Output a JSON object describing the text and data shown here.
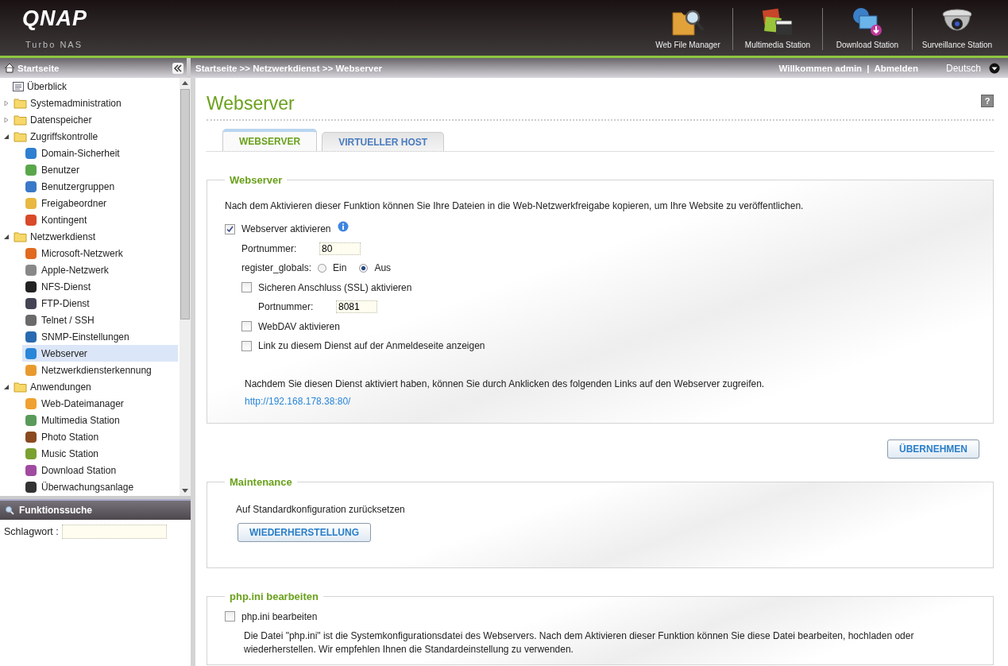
{
  "header": {
    "logo": "QNAP",
    "subtitle": "Turbo NAS",
    "shortcuts": [
      {
        "kind": "files",
        "label": "Web File Manager"
      },
      {
        "kind": "media",
        "label": "Multimedia Station"
      },
      {
        "kind": "download",
        "label": "Download Station"
      },
      {
        "kind": "camera",
        "label": "Surveillance Station"
      }
    ]
  },
  "sidebar": {
    "title": "Startseite",
    "tree": [
      {
        "label": "Überblick",
        "kind": "page"
      },
      {
        "label": "Systemadministration",
        "kind": "folder",
        "expanded": false
      },
      {
        "label": "Datenspeicher",
        "kind": "folder",
        "expanded": false
      },
      {
        "label": "Zugriffskontrolle",
        "kind": "folder",
        "expanded": true,
        "children": [
          {
            "label": "Domain-Sicherheit",
            "kind": "item",
            "selected": false
          },
          {
            "label": "Benutzer",
            "kind": "item",
            "selected": false
          },
          {
            "label": "Benutzergruppen",
            "kind": "item",
            "selected": false
          },
          {
            "label": "Freigabeordner",
            "kind": "item",
            "selected": false
          },
          {
            "label": "Kontingent",
            "kind": "item",
            "selected": false
          }
        ]
      },
      {
        "label": "Netzwerkdienst",
        "kind": "folder",
        "expanded": true,
        "children": [
          {
            "label": "Microsoft-Netzwerk",
            "kind": "item",
            "selected": false
          },
          {
            "label": "Apple-Netzwerk",
            "kind": "item",
            "selected": false
          },
          {
            "label": "NFS-Dienst",
            "kind": "item",
            "selected": false
          },
          {
            "label": "FTP-Dienst",
            "kind": "item",
            "selected": false
          },
          {
            "label": "Telnet / SSH",
            "kind": "item",
            "selected": false
          },
          {
            "label": "SNMP-Einstellungen",
            "kind": "item",
            "selected": false
          },
          {
            "label": "Webserver",
            "kind": "item",
            "selected": true
          },
          {
            "label": "Netzwerkdiensterkennung",
            "kind": "item",
            "selected": false
          }
        ]
      },
      {
        "label": "Anwendungen",
        "kind": "folder",
        "expanded": true,
        "children": [
          {
            "label": "Web-Dateimanager",
            "kind": "item",
            "selected": false
          },
          {
            "label": "Multimedia Station",
            "kind": "item",
            "selected": false
          },
          {
            "label": "Photo Station",
            "kind": "item",
            "selected": false
          },
          {
            "label": "Music Station",
            "kind": "item",
            "selected": false
          },
          {
            "label": "Download Station",
            "kind": "item",
            "selected": false
          },
          {
            "label": "Überwachungsanlage",
            "kind": "item",
            "selected": false
          }
        ]
      }
    ],
    "search": {
      "title": "Funktionssuche",
      "label": "Schlagwort :"
    }
  },
  "topbar": {
    "breadcrumb": "Startseite >> Netzwerkdienst >> Webserver",
    "welcome": "Willkommen admin",
    "separator": "|",
    "logout": "Abmelden",
    "language": "Deutsch"
  },
  "page": {
    "title": "Webserver",
    "help": "?",
    "tabs": [
      {
        "label": "WEBSERVER",
        "selected": true
      },
      {
        "label": "VIRTUELLER HOST",
        "selected": false
      }
    ]
  },
  "webserver": {
    "legend": "Webserver",
    "description": "Nach dem Aktivieren dieser Funktion können Sie Ihre Dateien in die Web-Netzwerkfreigabe kopieren, um Ihre Website zu veröffentlichen.",
    "options": [
      {
        "kind": "checkbox",
        "label": "Webserver aktivieren",
        "checked": true,
        "info": true,
        "children": [
          {
            "kind": "field",
            "label": "Portnummer:",
            "value": "80"
          },
          {
            "kind": "radio",
            "label": "register_globals:",
            "choices": [
              {
                "label": "Ein",
                "selected": false
              },
              {
                "label": "Aus",
                "selected": true
              }
            ]
          },
          {
            "kind": "checkbox",
            "label": "Sicheren Anschluss (SSL) aktivieren",
            "checked": false,
            "children": [
              {
                "kind": "field",
                "label": "Portnummer:",
                "value": "8081"
              }
            ]
          },
          {
            "kind": "checkbox",
            "label": "WebDAV aktivieren",
            "checked": false
          },
          {
            "kind": "checkbox",
            "label": "Link zu diesem Dienst auf der Anmeldeseite anzeigen",
            "checked": false
          }
        ]
      }
    ],
    "note": "Nachdem Sie diesen Dienst aktiviert haben, können Sie durch Anklicken des folgenden Links auf den Webserver zugreifen.",
    "link": "http://192.168.178.38:80/"
  },
  "apply_button": "ÜBERNEHMEN",
  "maintenance": {
    "legend": "Maintenance",
    "text": "Auf Standardkonfiguration zurücksetzen",
    "button": "WIEDERHERSTELLUNG"
  },
  "phpini": {
    "legend": "php.ini bearbeiten",
    "checkbox": {
      "label": "php.ini bearbeiten",
      "checked": false
    },
    "description": "Die Datei \"php.ini\" ist die Systemkonfigurationsdatei des Webservers. Nach dem Aktivieren dieser Funktion können Sie diese Datei bearbeiten, hochladen oder wiederherstellen. Wir empfehlen Ihnen die Standardeinstellung zu verwenden."
  }
}
